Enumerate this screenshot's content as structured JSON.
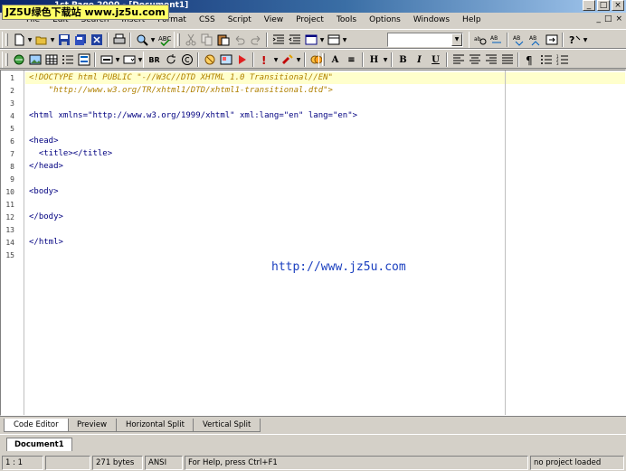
{
  "window": {
    "title": "1st Page 2000 - [Document1]",
    "watermark": "JZ5U绿色下载站 www.jz5u.com",
    "buttons": [
      "_",
      "□",
      "×"
    ]
  },
  "menu": {
    "items": [
      "File",
      "Edit",
      "Search",
      "Insert",
      "Format",
      "CSS",
      "Script",
      "View",
      "Project",
      "Tools",
      "Options",
      "Windows",
      "Help"
    ],
    "mdi_buttons": [
      "_",
      "□",
      "×"
    ]
  },
  "toolbar1": {
    "groupA": [
      "new-file-icon",
      "open-folder-icon",
      "save-icon",
      "save-all-icon",
      "close-file-icon",
      "print-icon",
      "preview-icon",
      "spellcheck-icon"
    ],
    "groupB": [
      "cut-icon",
      "copy-icon",
      "paste-icon",
      "undo-icon",
      "redo-icon",
      "indent-icon",
      "outdent-icon",
      "frame-icon",
      "window-icon"
    ],
    "combo_value": "",
    "groupC": [
      "find-icon",
      "replace-icon",
      "find-next-icon",
      "find-prev-icon",
      "goto-icon",
      "help-icon"
    ]
  },
  "toolbar2": {
    "groupA": [
      "anchor-icon",
      "image-icon",
      "table-icon",
      "list-icon",
      "form-icon",
      "hr-icon",
      "dropdown-icon"
    ],
    "groupB": [
      "br-label",
      "refresh-icon",
      "copyright-icon",
      "color-icon",
      "image-map-icon",
      "arrow-icon",
      "help-tip-icon",
      "applet-icon",
      "magic-icon"
    ],
    "br_label": "BR",
    "text_format": [
      "A",
      "≡",
      "H"
    ],
    "style_buttons": [
      "B",
      "I",
      "U"
    ],
    "align": [
      "align-left-icon",
      "align-center-icon",
      "align-right-icon",
      "justify-icon",
      "paragraph-icon",
      "ul-icon",
      "ol-icon"
    ]
  },
  "editor": {
    "line_numbers": [
      "1",
      "2",
      "3",
      "4",
      "5",
      "6",
      "7",
      "8",
      "9",
      "10",
      "11",
      "12",
      "13",
      "14",
      "15"
    ],
    "lines": [
      "<!DOCTYPE html PUBLIC \"-//W3C//DTD XHTML 1.0 Transitional//EN\"",
      "    \"http://www.w3.org/TR/xhtml1/DTD/xhtml1-transitional.dtd\">",
      "",
      "<html xmlns=\"http://www.w3.org/1999/xhtml\" xml:lang=\"en\" lang=\"en\">",
      "",
      "<head>",
      "  <title></title>",
      "</head>",
      "",
      "<body>",
      "",
      "</body>",
      "",
      "</html>",
      ""
    ],
    "overlay_url": "http://www.jz5u.com"
  },
  "view_tabs": [
    "Code Editor",
    "Preview",
    "Horizontal Split",
    "Vertical Split"
  ],
  "document_tabs": [
    "Document1"
  ],
  "status": {
    "position": "1 : 1",
    "blank": "",
    "size": "271 bytes",
    "encoding": "ANSI",
    "hint": "For Help, press Ctrl+F1",
    "project": "no project loaded"
  }
}
